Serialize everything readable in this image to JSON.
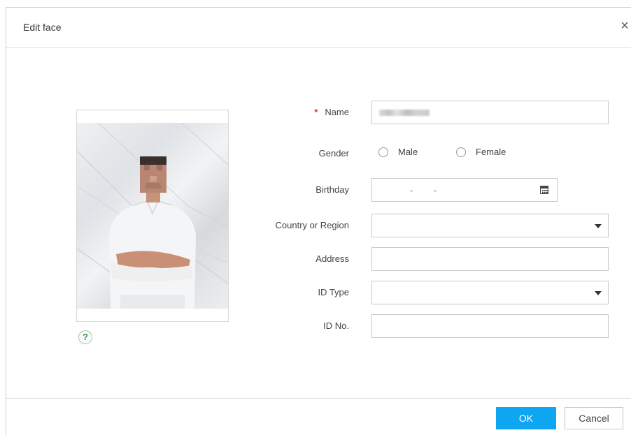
{
  "dialog": {
    "title": "Edit face",
    "close_glyph": "×",
    "help_glyph": "?"
  },
  "form": {
    "name": {
      "label": "Name",
      "required_mark": "*",
      "value": ""
    },
    "gender": {
      "label": "Gender",
      "options": [
        "Male",
        "Female"
      ],
      "selected": null
    },
    "birthday": {
      "label": "Birthday",
      "separator": "-",
      "icon": "calendar-icon"
    },
    "country": {
      "label": "Country or Region",
      "value": ""
    },
    "address": {
      "label": "Address",
      "value": ""
    },
    "id_type": {
      "label": "ID Type",
      "value": ""
    },
    "id_no": {
      "label": "ID No.",
      "value": ""
    }
  },
  "buttons": {
    "ok": "OK",
    "cancel": "Cancel"
  },
  "colors": {
    "accent": "#0ea6f0",
    "required": "#e5352b",
    "help": "#2e9d3a"
  }
}
